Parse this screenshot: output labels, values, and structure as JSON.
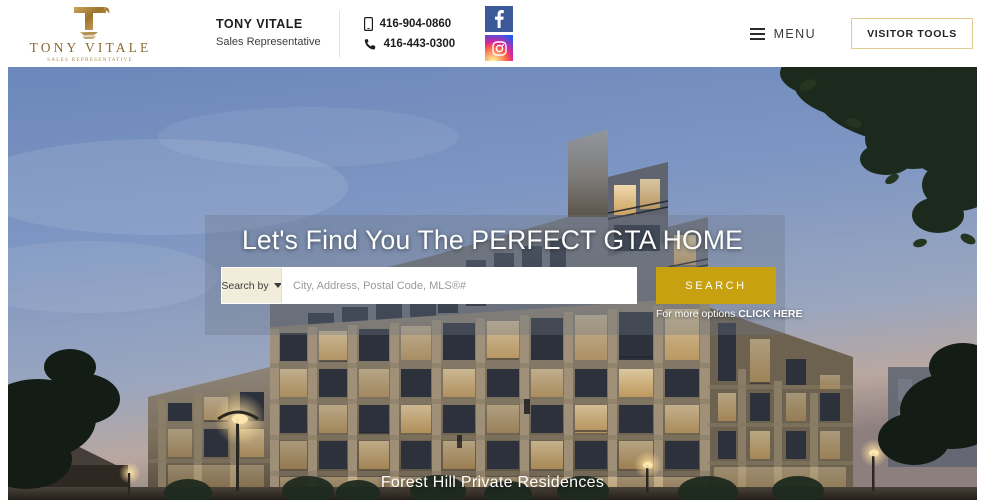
{
  "header": {
    "logo": {
      "monogram": "T",
      "name": "TONY VITALE",
      "subtitle": "SALES REPRESENTATIVE"
    },
    "agent": {
      "name": "TONY VITALE",
      "role": "Sales Representative"
    },
    "phones": [
      {
        "icon": "mobile-icon",
        "number": "416-904-0860"
      },
      {
        "icon": "phone-icon",
        "number": "416-443-0300"
      }
    ],
    "social": [
      {
        "icon": "facebook-icon",
        "glyph": "f",
        "color": "#3b5998"
      },
      {
        "icon": "instagram-icon",
        "glyph": "instagram",
        "color": "#d6249f"
      }
    ],
    "menu_label": "MENU",
    "visitor_tools_label": "VISITOR TOOLS"
  },
  "hero": {
    "headline": "Let's Find You The PERFECT GTA HOME",
    "caption": "Forest Hill Private Residences",
    "search": {
      "search_by_label": "Search by",
      "placeholder": "City, Address, Postal Code, MLS®#",
      "value": "",
      "button_label": "SEARCH"
    },
    "more_options": {
      "prefix": "For more options ",
      "link": "CLICK HERE"
    }
  },
  "colors": {
    "gold": "#c8a111",
    "gold_border": "#e3ca8e",
    "logo_bronze": "#8a6a32",
    "cream": "#f2ecdb",
    "facebook_blue": "#3b5998"
  }
}
